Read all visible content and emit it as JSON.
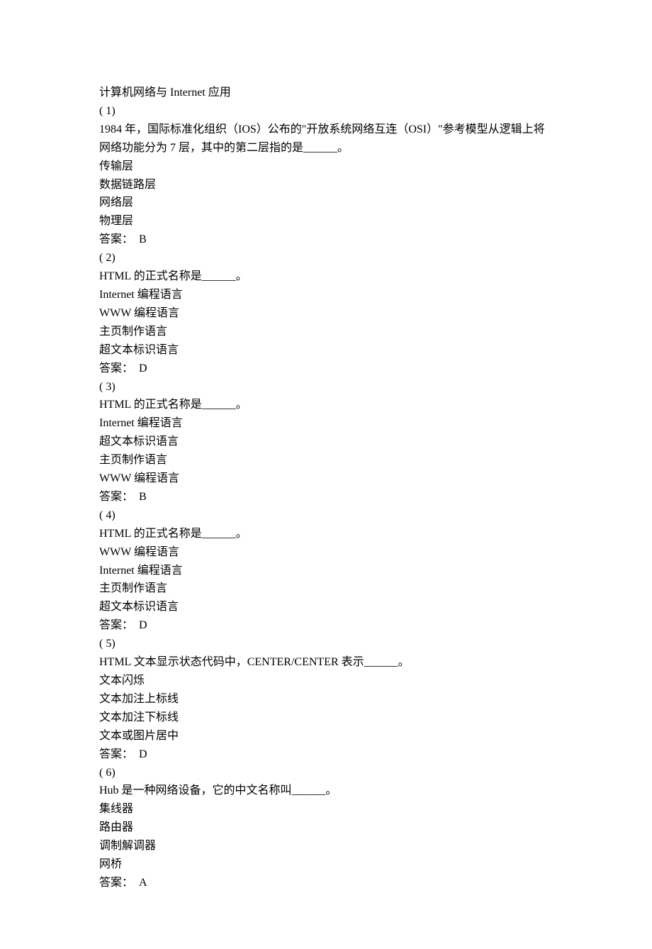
{
  "title": "计算机网络与 Internet 应用",
  "questions": [
    {
      "num": "( 1)",
      "stem": "1984 年，国际标准化组织（IOS）公布的\"开放系统网络互连（OSI）\"参考模型从逻辑上将网络功能分为 7 层，其中的第二层指的是______。",
      "options": [
        "传输层",
        "数据链路层",
        "网络层",
        "物理层"
      ],
      "answer": "答案：  B"
    },
    {
      "num": "( 2)",
      "stem": "HTML 的正式名称是______。",
      "options": [
        "Internet 编程语言",
        "WWW 编程语言",
        "主页制作语言",
        "超文本标识语言"
      ],
      "answer": "答案：  D"
    },
    {
      "num": "( 3)",
      "stem": "HTML 的正式名称是______。",
      "options": [
        "Internet 编程语言",
        "超文本标识语言",
        "主页制作语言",
        "WWW 编程语言"
      ],
      "answer": "答案：  B"
    },
    {
      "num": "( 4)",
      "stem": "HTML 的正式名称是______。",
      "options": [
        "WWW 编程语言",
        "Internet 编程语言",
        "主页制作语言",
        "超文本标识语言"
      ],
      "answer": "答案：  D"
    },
    {
      "num": "( 5)",
      "stem": "HTML 文本显示状态代码中，CENTER/CENTER 表示______。",
      "options": [
        "文本闪烁",
        "文本加注上标线",
        "文本加注下标线",
        "文本或图片居中"
      ],
      "answer": "答案：  D"
    },
    {
      "num": "( 6)",
      "stem": "Hub 是一种网络设备，它的中文名称叫______。",
      "options": [
        "集线器",
        "路由器",
        "调制解调器",
        "网桥"
      ],
      "answer": "答案：  A"
    }
  ]
}
